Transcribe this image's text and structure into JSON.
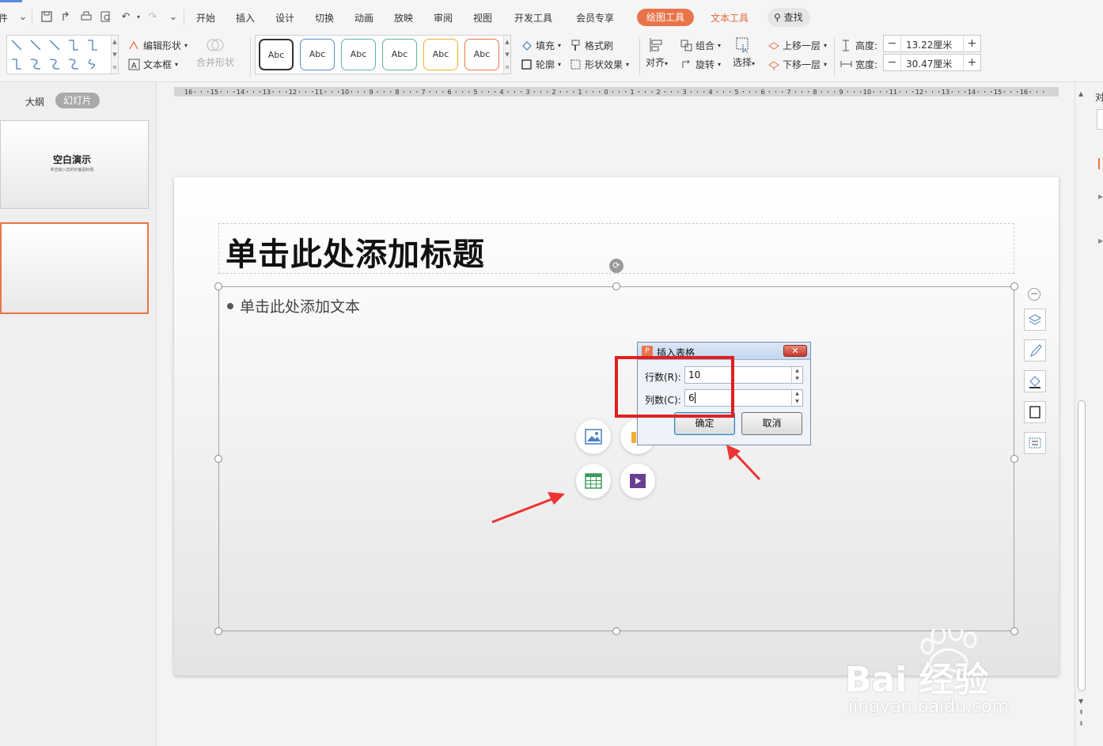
{
  "menubar": {
    "file_label": "文件",
    "items": [
      "开始",
      "插入",
      "设计",
      "切换",
      "动画",
      "放映",
      "审阅",
      "视图",
      "开发工具",
      "会员专享"
    ],
    "drawing_tools": "绘图工具",
    "text_tools": "文本工具",
    "search": "查找"
  },
  "ribbon": {
    "edit_shape": "编辑形状",
    "text_box": "文本框",
    "merge_shapes": "合并形状",
    "style_samples": [
      "Abc",
      "Abc",
      "Abc",
      "Abc",
      "Abc",
      "Abc"
    ],
    "style_border_colors": [
      "#333333",
      "#5b8fc7",
      "#5fb0b8",
      "#5cb88f",
      "#f0b030",
      "#e8744a"
    ],
    "fill": "填充",
    "outline": "轮廓",
    "format_painter": "格式刷",
    "shape_effects": "形状效果",
    "align": "对齐",
    "group": "组合",
    "rotate": "旋转",
    "select": "选择",
    "bring_forward": "上移一层",
    "send_backward": "下移一层",
    "height_label": "高度:",
    "height_value": "13.22厘米",
    "width_label": "宽度:",
    "width_value": "30.47厘米"
  },
  "left_panel": {
    "tab_outline": "大纲",
    "tab_slides": "幻灯片",
    "thumb1_title": "空白演示",
    "thumb1_sub": "单击输入您的封面副标题"
  },
  "ruler": {
    "ticks": [
      "16",
      "15",
      "14",
      "13",
      "12",
      "11",
      "10",
      "9",
      "8",
      "7",
      "6",
      "5",
      "4",
      "3",
      "2",
      "1",
      "0",
      "1",
      "2",
      "3",
      "4",
      "5",
      "6",
      "7",
      "8",
      "9",
      "10",
      "11",
      "12",
      "13",
      "14",
      "15",
      "16"
    ]
  },
  "slide": {
    "title_placeholder": "单击此处添加标题",
    "body_placeholder": "单击此处添加文本"
  },
  "dialog": {
    "title": "插入表格",
    "rows_label": "行数(R):",
    "rows_value": "10",
    "cols_label": "列数(C):",
    "cols_value": "6",
    "ok": "确定",
    "cancel": "取消"
  },
  "right_panel": {
    "label": "对"
  },
  "watermark": {
    "brand": "Bai 经验",
    "url": "jingyan.baidu.com"
  }
}
